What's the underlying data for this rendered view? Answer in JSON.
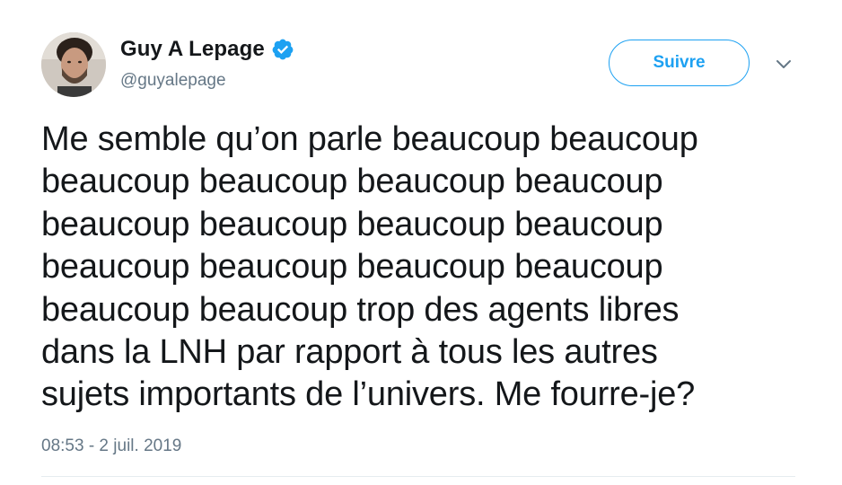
{
  "tweet": {
    "author": {
      "display_name": "Guy A Lepage",
      "handle": "@guyalepage",
      "verified_icon": "verified-badge-icon",
      "avatar_icon": "user-avatar-photo"
    },
    "follow_button_label": "Suivre",
    "menu_icon": "chevron-down-icon",
    "text": "Me semble qu’on parle beaucoup beaucoup\nbeaucoup beaucoup beaucoup beaucoup\nbeaucoup beaucoup beaucoup beaucoup\nbeaucoup beaucoup beaucoup beaucoup\nbeaucoup beaucoup trop des agents libres\ndans la LNH par rapport à tous les autres\nsujets importants de l’univers. Me fourre-je?",
    "timestamp": "08:53 - 2 juil. 2019"
  },
  "colors": {
    "accent": "#1da1f2",
    "text_primary": "#14171a",
    "text_secondary": "#657786",
    "divider": "#e6ecf0"
  }
}
